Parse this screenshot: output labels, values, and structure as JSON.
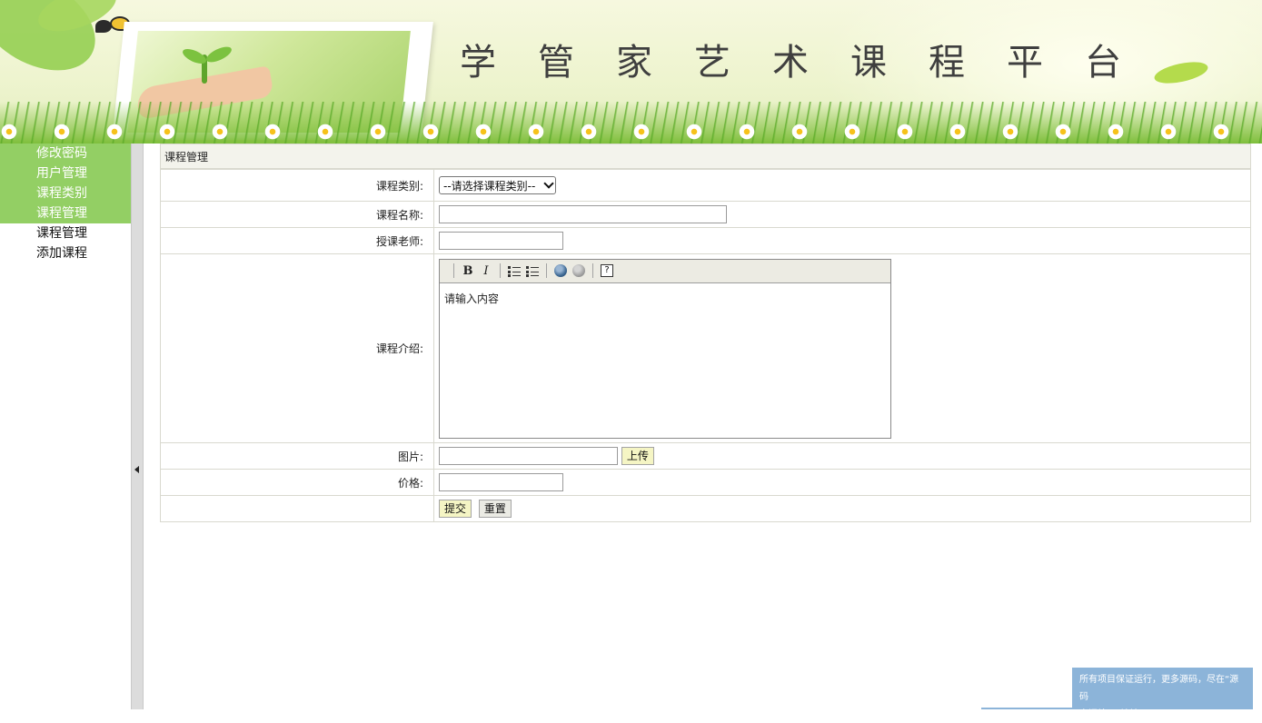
{
  "banner": {
    "title": "学管家艺术课程平台"
  },
  "sidebar": {
    "groups": [
      {
        "label": "修改密码"
      },
      {
        "label": "用户管理"
      },
      {
        "label": "课程类别"
      },
      {
        "label": "课程管理"
      }
    ],
    "subitems": [
      {
        "label": "课程管理"
      },
      {
        "label": "添加课程"
      }
    ]
  },
  "panel": {
    "title": "课程管理"
  },
  "form": {
    "category_label": "课程类别:",
    "category_selected": "--请选择课程类别--",
    "name_label": "课程名称:",
    "name_value": "",
    "teacher_label": "授课老师:",
    "teacher_value": "",
    "intro_label": "课程介绍:",
    "intro_placeholder": "请输入内容",
    "image_label": "图片:",
    "image_value": "",
    "upload_button": "上传",
    "price_label": "价格:",
    "price_value": "",
    "submit_button": "提交",
    "reset_button": "重置"
  },
  "editor": {
    "toolbar": [
      "bold-icon",
      "italic-icon",
      "ordered-list-icon",
      "unordered-list-icon",
      "link-globe-icon",
      "unlink-globe-icon",
      "help-icon"
    ],
    "bold_glyph": "B",
    "italic_glyph": "I",
    "help_glyph": "?"
  },
  "notice": {
    "line1": "所有项目保证运行，更多源码，尽在“源码",
    "line2": "空间站”，地址: www.shuyue.fun"
  },
  "colors": {
    "sidebar_group_bg": "#93cf64",
    "button_bg": "#f5f5c4",
    "notice_bg": "#8cb4d9"
  }
}
